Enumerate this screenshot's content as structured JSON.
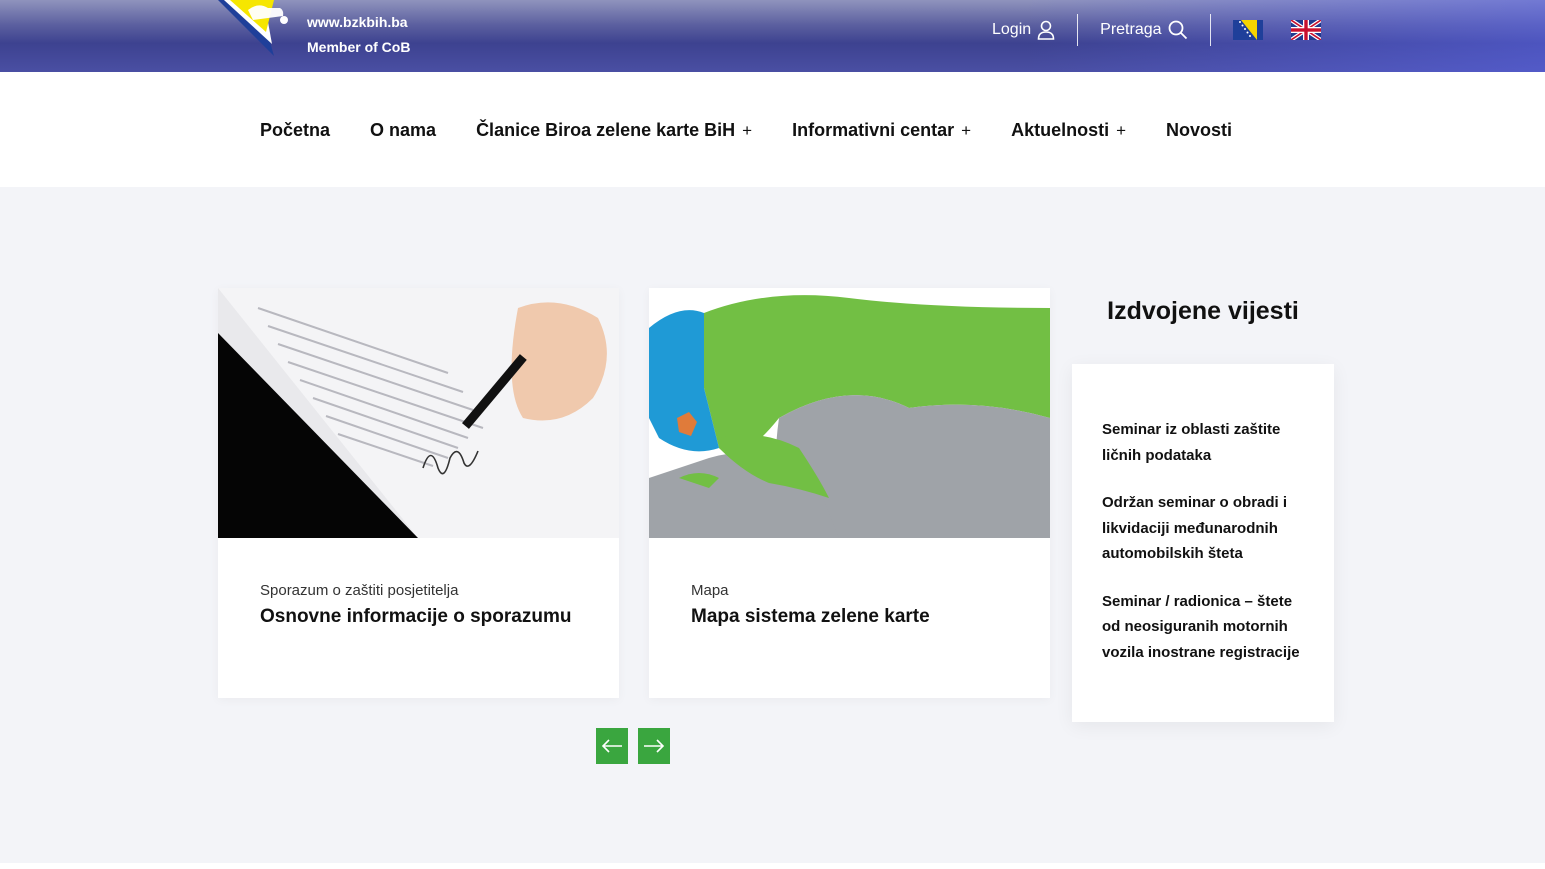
{
  "header": {
    "site_url": "www.bzkbih.ba",
    "member_text": "Member of CoB",
    "login_label": "Login",
    "search_label": "Pretraga"
  },
  "nav": {
    "items": [
      {
        "label": "Početna",
        "has_submenu": false
      },
      {
        "label": "O nama",
        "has_submenu": false
      },
      {
        "label": "Članice Biroa zelene karte BiH",
        "has_submenu": true
      },
      {
        "label": "Informativni centar",
        "has_submenu": true
      },
      {
        "label": "Aktuelnosti",
        "has_submenu": true
      },
      {
        "label": "Novosti",
        "has_submenu": false
      }
    ],
    "submenu_symbol": "+"
  },
  "cards": [
    {
      "category": "Sporazum o zaštiti posjetitelja",
      "title": "Osnovne informacije o sporazumu",
      "image": "signing-document-photo"
    },
    {
      "category": "Mapa",
      "title": "Mapa sistema zelene karte",
      "image": "green-card-system-map"
    }
  ],
  "featured": {
    "title": "Izdvojene vijesti",
    "items": [
      "Seminar iz oblasti zaštite ličnih podataka",
      "Održan seminar o obradi i likvidaciji međunarodnih automobilskih šteta",
      "Seminar / radionica – štete od neosiguranih motornih vozila inostrane registracije"
    ]
  },
  "carousel": {
    "prev_icon": "arrow-left-icon",
    "next_icon": "arrow-right-icon"
  },
  "colors": {
    "accent": "#3aa63f",
    "topbar": "#3d4290",
    "map_green": "#72bf44",
    "map_blue": "#1f9ad6",
    "map_grey": "#9fa3a8"
  }
}
